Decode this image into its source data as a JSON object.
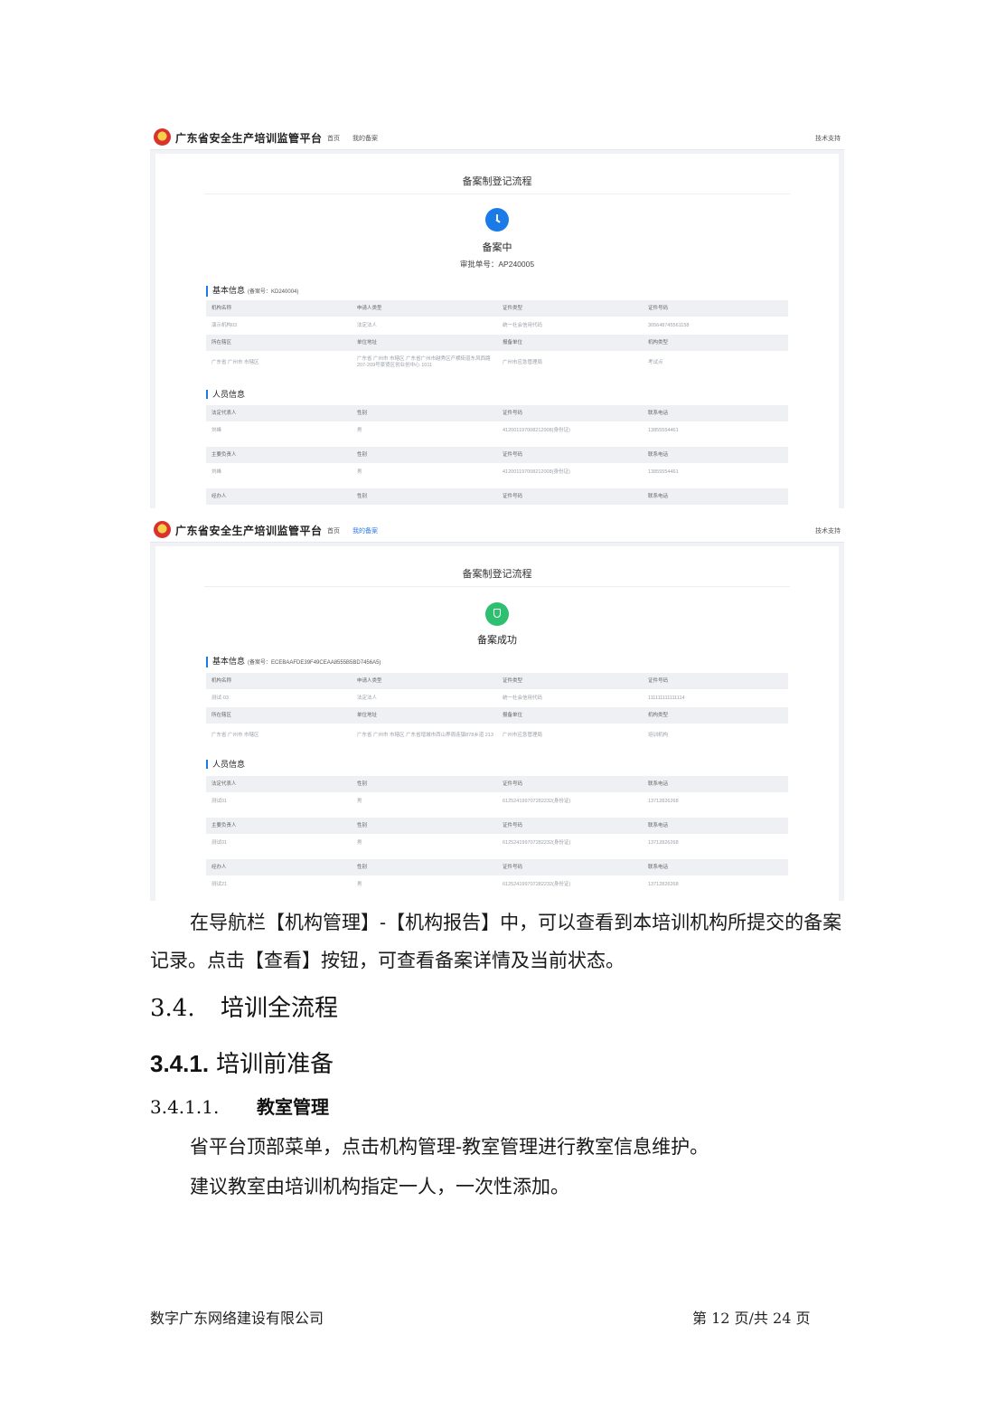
{
  "platform": {
    "name": "广东省安全生产培训监管平台",
    "nav": [
      "首页",
      "我的备案"
    ],
    "support": "技术支持"
  },
  "shot1": {
    "flow_title": "备案制登记流程",
    "status": "备案中",
    "approval": "审批单号：AP240005",
    "basic_title": "基本信息",
    "basic_code": "(备案号：KD240004)",
    "basic_rows": [
      [
        "机构名称",
        "申请人类型",
        "证件类型",
        "证件号码"
      ],
      [
        "演示机构03",
        "法定法人",
        "统一社会信用代码",
        "305648745561158"
      ],
      [
        "所在辖区",
        "单位地址",
        "报备单位",
        "机构类型"
      ],
      [
        "广东省 广州市 市辖区",
        "广东省 广州市 市辖区 广东省广州市越秀区产横街道东风西路207-209号豪贤区创业创中心 1011",
        "广州市应急管理局",
        "考试点"
      ]
    ],
    "person_title": "人员信息",
    "person_blocks": [
      [
        [
          "法定代表人",
          "性别",
          "证件号码",
          "联系电话"
        ],
        [
          "刘峰",
          "男",
          "412001197008212008(身份证)",
          "13855554461"
        ]
      ],
      [
        [
          "主要负责人",
          "性别",
          "证件号码",
          "联系电话"
        ],
        [
          "刘峰",
          "男",
          "412001197008212008(身份证)",
          "13855554461"
        ]
      ],
      [
        [
          "经办人",
          "性别",
          "证件号码",
          "联系电话"
        ]
      ]
    ]
  },
  "shot2": {
    "flow_title": "备案制登记流程",
    "status": "备案成功",
    "basic_title": "基本信息",
    "basic_code": "(备案号：ECEBAAFDE39F49CEAA8555B5BD7456A5)",
    "basic_rows": [
      [
        "机构名称",
        "申请人类型",
        "证件类型",
        "证件号码"
      ],
      [
        "测试-03",
        "法定法人",
        "统一社会信用代码",
        "111111111111114"
      ],
      [
        "所在辖区",
        "单位地址",
        "报备单位",
        "机构类型"
      ],
      [
        "广东省 广州市 市辖区",
        "广东省 广州市 市辖区 广东省增城市西山界周连镇878乡道 213",
        "广州市应急管理局",
        "培训机构"
      ]
    ],
    "person_title": "人员信息",
    "person_blocks": [
      [
        [
          "法定代表人",
          "性别",
          "证件号码",
          "联系电话"
        ],
        [
          "测试01",
          "男",
          "612524199707282232(身份证)",
          "13712826268"
        ]
      ],
      [
        [
          "主要负责人",
          "性别",
          "证件号码",
          "联系电话"
        ],
        [
          "测试01",
          "男",
          "612524199707282232(身份证)",
          "13712826268"
        ]
      ],
      [
        [
          "经办人",
          "性别",
          "证件号码",
          "联系电话"
        ],
        [
          "测试21",
          "男",
          "612524199707282232(身份证)",
          "13712826268"
        ]
      ]
    ]
  },
  "doc": {
    "para1": "在导航栏【机构管理】-【机构报告】中，可以查看到本培训机构所提交的备案记录。点击【查看】按钮，可查看备案详情及当前状态。",
    "h2_num": "3.4.",
    "h2_text": "培训全流程",
    "h3_num": "3.4.1.",
    "h3_text": "培训前准备",
    "h4_num": "3.4.1.1.",
    "h4_text": "教室管理",
    "line1": "省平台顶部菜单，点击机构管理-教室管理进行教室信息维护。",
    "line2": "建议教室由培训机构指定一人，一次性添加。"
  },
  "footer": {
    "company": "数字广东网络建设有限公司",
    "page": "第 12 页/共 24 页"
  }
}
